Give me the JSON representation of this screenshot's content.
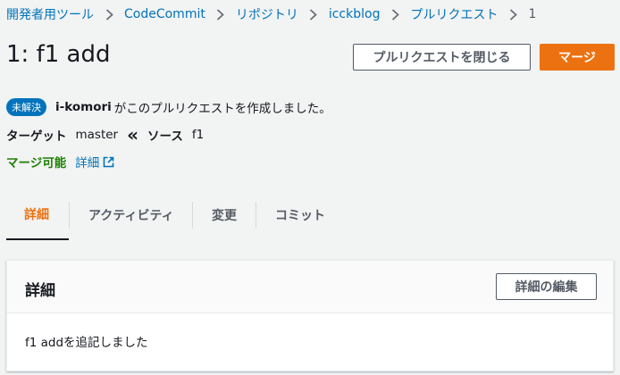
{
  "breadcrumb": {
    "items": [
      "開発者用ツール",
      "CodeCommit",
      "リポジトリ",
      "icckblog",
      "プルリクエスト"
    ],
    "current": "1"
  },
  "pull_request": {
    "title": "1: f1 add",
    "status": "未解決",
    "author": "i-komori",
    "created_text": "がこのプルリクエストを作成しました。",
    "target_label": "ターゲット",
    "target_branch": "master",
    "source_label": "ソース",
    "source_branch": "f1",
    "merge_status": "マージ可能",
    "detail_link": "詳細"
  },
  "actions": {
    "close_label": "プルリクエストを閉じる",
    "merge_label": "マージ"
  },
  "tabs": [
    {
      "label": "詳細",
      "active": true
    },
    {
      "label": "アクティビティ",
      "active": false
    },
    {
      "label": "変更",
      "active": false
    },
    {
      "label": "コミット",
      "active": false
    }
  ],
  "details_panel": {
    "title": "詳細",
    "edit_label": "詳細の編集",
    "description": "f1 addを追記しました"
  },
  "colors": {
    "link": "#0073bb",
    "accent": "#ec7211",
    "success": "#1d8102",
    "badge": "#0073bb"
  }
}
